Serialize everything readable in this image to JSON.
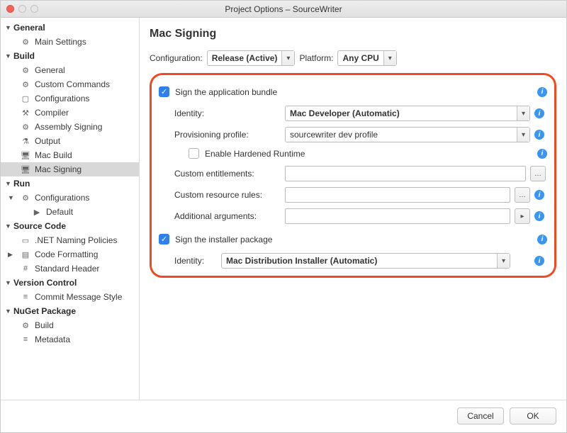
{
  "window": {
    "title": "Project Options – SourceWriter"
  },
  "sidebar": {
    "general": {
      "label": "General",
      "main_settings": "Main Settings"
    },
    "build": {
      "label": "Build",
      "general": "General",
      "custom_commands": "Custom Commands",
      "configurations": "Configurations",
      "compiler": "Compiler",
      "assembly_signing": "Assembly Signing",
      "output": "Output",
      "mac_build": "Mac Build",
      "mac_signing": "Mac Signing"
    },
    "run": {
      "label": "Run",
      "configurations": "Configurations",
      "default": "Default"
    },
    "source_code": {
      "label": "Source Code",
      "naming": ".NET Naming Policies",
      "formatting": "Code Formatting",
      "standard_header": "Standard Header"
    },
    "version_control": {
      "label": "Version Control",
      "commit_msg": "Commit Message Style"
    },
    "nuget": {
      "label": "NuGet Package",
      "build": "Build",
      "metadata": "Metadata"
    }
  },
  "page": {
    "heading": "Mac Signing",
    "configuration_label": "Configuration:",
    "configuration_value": "Release (Active)",
    "platform_label": "Platform:",
    "platform_value": "Any CPU",
    "sign_app_label": "Sign the application bundle",
    "sign_app_checked": true,
    "identity_label": "Identity:",
    "identity_value": "Mac Developer (Automatic)",
    "provisioning_label": "Provisioning profile:",
    "provisioning_value": "sourcewriter dev profile",
    "hardened_label": "Enable Hardened Runtime",
    "hardened_checked": false,
    "entitlements_label": "Custom entitlements:",
    "entitlements_value": "",
    "resource_rules_label": "Custom resource rules:",
    "resource_rules_value": "",
    "additional_args_label": "Additional arguments:",
    "additional_args_value": "",
    "sign_installer_label": "Sign the installer package",
    "sign_installer_checked": true,
    "installer_identity_label": "Identity:",
    "installer_identity_value": "Mac Distribution Installer (Automatic)"
  },
  "footer": {
    "cancel": "Cancel",
    "ok": "OK"
  }
}
